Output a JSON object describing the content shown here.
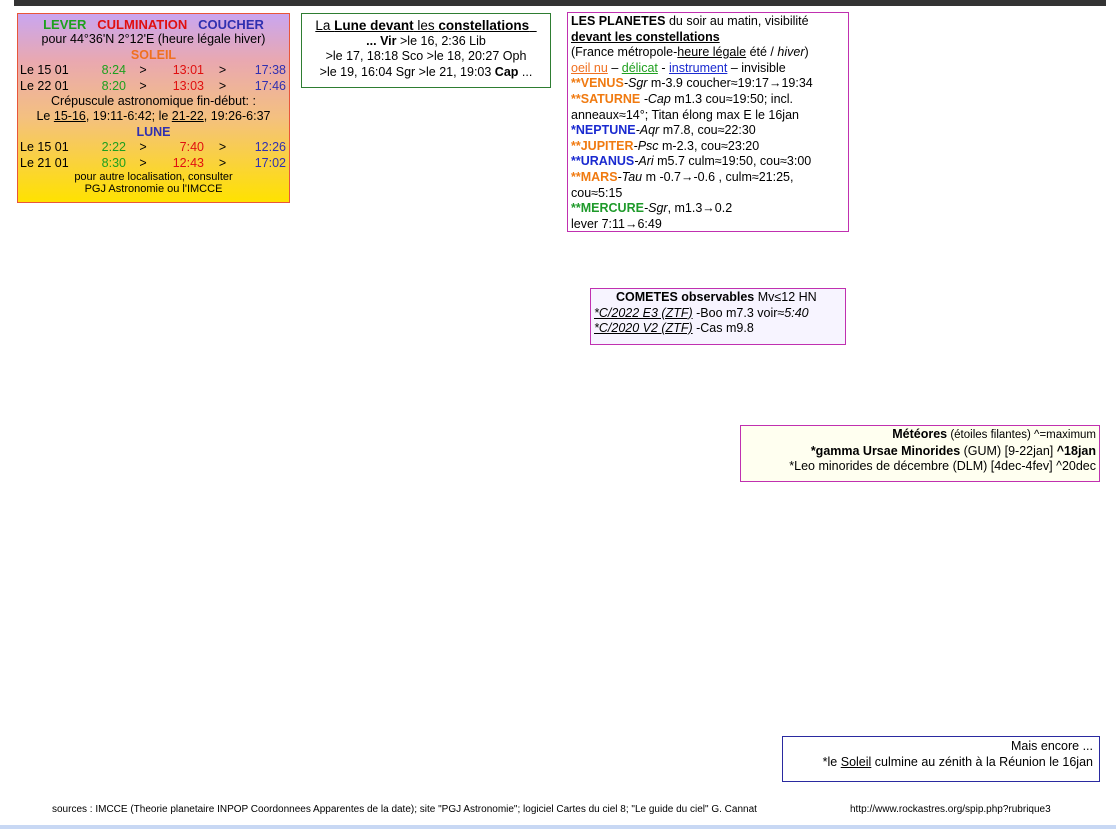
{
  "sun_box": {
    "h_lever": "LEVER",
    "h_culm": "CULMINATION",
    "h_coucher": "COUCHER",
    "location": "pour 44°36'N  2°12'E (heure légale hiver)",
    "soleil_title": "SOLEIL",
    "sun_rows": [
      {
        "date": "Le 15 01",
        "lever": "8:24",
        "culm": "13:01",
        "coucher": "17:38"
      },
      {
        "date": "Le 22 01",
        "lever": "8:20",
        "culm": "13:03",
        "coucher": "17:46"
      }
    ],
    "arrow": ">",
    "crep_title": "Crépuscule astronomique fin-début: :",
    "crep_le1": "Le ",
    "crep_d1": "15-16",
    "crep_t1": ", 19:11-6:42; le ",
    "crep_d2": "21-22",
    "crep_t2": ", 19:26-6:37",
    "lune_title": "LUNE",
    "moon_rows": [
      {
        "date": "Le 15 01",
        "lever": "2:22",
        "culm": "7:40",
        "coucher": "12:26"
      },
      {
        "date": "Le 21 01",
        "lever": "8:30",
        "culm": "12:43",
        "coucher": "17:02"
      }
    ],
    "note1": "pour autre localisation, consulter",
    "note2": "PGJ Astronomie ou l'IMCCE"
  },
  "moon_const": {
    "t_la": "La ",
    "t_lune": "Lune devant",
    "t_les": " les ",
    "t_const": "constellations",
    "line1_a": "... Vir",
    "line1_b": " >le 16, 2:36 Lib",
    "line2": ">le 17, 18:18 Sco >le 18, 20:27 Oph",
    "line3_a": ">le 19, 16:04 Sgr >le 21, 19:03 ",
    "line3_b": "Cap",
    "line3_c": " ..."
  },
  "planets": {
    "title": "LES PLANETES",
    "title_rest": " du soir au matin, visibilité",
    "subtitle": "devant les constellations",
    "france_a": "(France métropole-",
    "france_b": "heure légale",
    "france_c": " été / ",
    "france_d": "hiver",
    "france_e": ")",
    "leg_oeil": "oeil nu",
    "leg_sep1": " – ",
    "leg_delicat": "délicat",
    "leg_sep2": " - ",
    "leg_instr": "instrument",
    "leg_sep3": " – ",
    "leg_invis": "invisible",
    "venus_star": "**",
    "venus": "VENUS",
    "venus_c": "-Sgr",
    "venus_t": " m-3.9 coucher≈19:17→19:34",
    "saturne_star": "**",
    "saturne": "SATURNE",
    "saturne_c": " -Cap",
    "saturne_t": " m1.3 cou≈19:50; incl.",
    "saturne_t2": "anneaux≈14°; Titan élong max E le 16jan",
    "neptune_star": "*",
    "neptune": "NEPTUNE",
    "neptune_c": "-Aqr",
    "neptune_t": " m7.8, cou≈22:30",
    "jupiter_star": "**",
    "jupiter": "JUPITER",
    "jupiter_c": "-Psc",
    "jupiter_t": " m-2.3, cou≈23:20",
    "uranus_star": "**",
    "uranus": "URANUS",
    "uranus_c": "-Ari",
    "uranus_t": " m5.7 culm≈19:50, cou≈3:00",
    "mars_star": "**",
    "mars": "MARS",
    "mars_c": "-Tau",
    "mars_t": " m -0.7→-0.6 , culm≈21:25,",
    "mars_t2": "cou≈5:15",
    "mercure_star": "**",
    "mercure": "MERCURE",
    "mercure_c": "-Sgr",
    "mercure_t": ", m1.3→0.2",
    "mercure_t2": "lever 7:11→6:49"
  },
  "comets": {
    "title": "COMETES observables",
    "title_rest": " Mv≤12 HN",
    "c1_name": "*C/2022 E3 (ZTF)",
    "c1_a": " -Boo m7.3 voir≈",
    "c1_b": "5:40",
    "c2_name": "*C/2020 V2 (ZTF)",
    "c2_a": " -Cas m9.8"
  },
  "meteors": {
    "title": "Météores",
    "title_rest": " (étoiles filantes) ^=maximum",
    "m1_name": "*gamma Ursae Minorides",
    "m1_a": " (GUM) [9-22jan] ",
    "m1_max": "^18jan",
    "m2": "*Leo minorides de décembre (DLM) [4dec-4fev] ^20dec"
  },
  "more": {
    "title": "Mais encore ...",
    "line_a": "*le ",
    "line_b": "Soleil",
    "line_c": " culmine au zénith à la Réunion le 16jan"
  },
  "footer": {
    "sources": "sources : IMCCE (Theorie planetaire INPOP Coordonnees Apparentes de la date); site \"PGJ Astronomie\"; logiciel  Cartes du ciel 8; \"Le guide du ciel\" G. Cannat",
    "url": "http://www.rockastres.org/spip.php?rubrique3"
  }
}
